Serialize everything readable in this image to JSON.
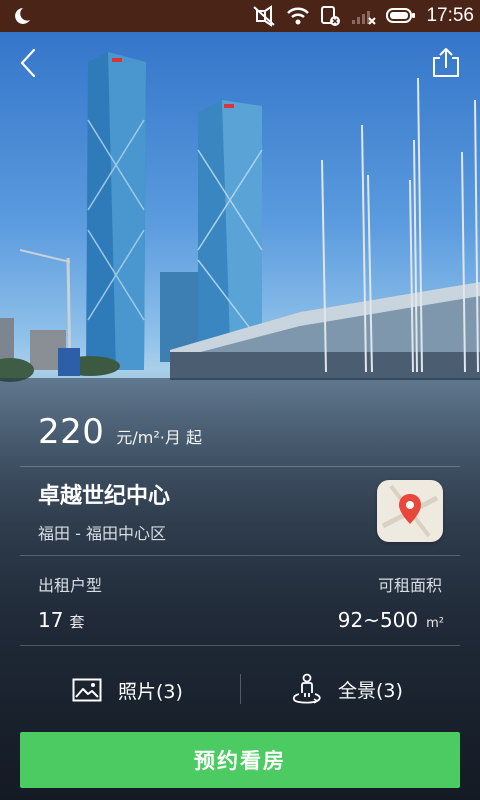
{
  "status_bar": {
    "time": "17:56",
    "icons": [
      "moon-icon",
      "mute-icon",
      "wifi-icon",
      "sim-icon",
      "signal-icon",
      "battery-icon"
    ]
  },
  "nav": {
    "back_icon": "chevron-left-icon",
    "share_icon": "share-icon"
  },
  "listing": {
    "price": "220",
    "price_unit": "元/m²·月 起",
    "building_name": "卓越世纪中心",
    "location": "福田 - 福田中心区",
    "map_icon": "map-icon",
    "unit_type_label": "出租户型",
    "unit_count": "17",
    "unit_count_suffix": "套",
    "area_label": "可租面积",
    "area_value": "92~500",
    "area_unit": "m²"
  },
  "media_tabs": {
    "photos_label": "照片(3)",
    "panorama_label": "全景(3)"
  },
  "actions": {
    "book_label": "预约看房"
  },
  "colors": {
    "status_bar": "#4a2416",
    "book_button": "#4ccb62",
    "map_pin": "#e8473b"
  }
}
